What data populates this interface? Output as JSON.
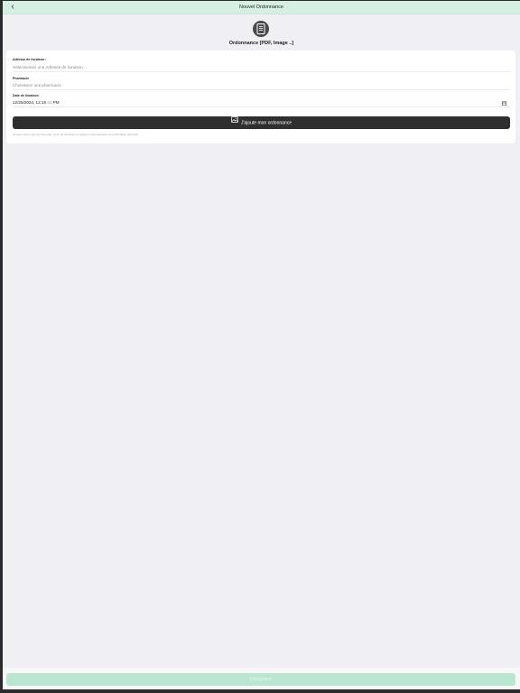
{
  "header": {
    "title": "Nouvel Ordonnance",
    "back_icon": "chevron-left-icon"
  },
  "document": {
    "icon": "document-icon",
    "title": "Ordonnance [PDF, Image ..]"
  },
  "form": {
    "address": {
      "label": "Adresse de livraison :",
      "placeholder": "Sélectionnez une Adresse de livraison"
    },
    "pharmacy": {
      "label": "Pharmacie",
      "placeholder": "Choisissez une pharmacie"
    },
    "date": {
      "label": "Date de livraison",
      "value_main": "12/25/2024, 12:16 ",
      "value_dim": "54",
      "value_suffix": " PM",
      "icon": "calendar-icon"
    },
    "add_button": {
      "label": "J'ajoute mon ordonnance",
      "icon": "image-icon"
    },
    "note": "Si vous n'avez pas reçu de code, merci de contacter le support ou de réessayer la confirmation plus tard."
  },
  "footer": {
    "save_label": "Enregistrer"
  }
}
